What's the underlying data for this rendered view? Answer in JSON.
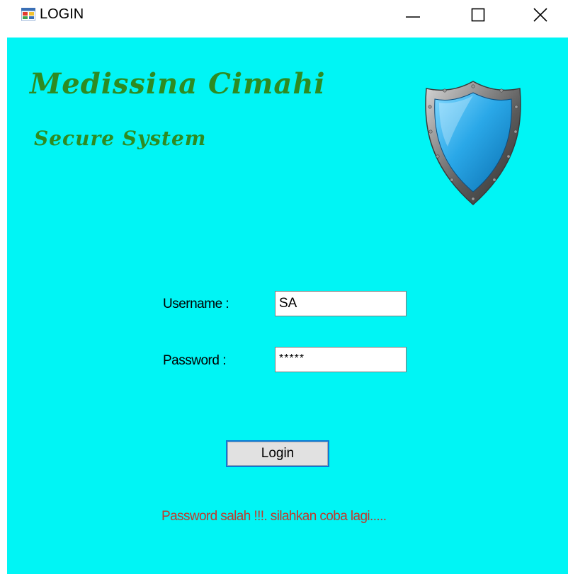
{
  "window": {
    "title": "LOGIN"
  },
  "branding": {
    "title": "Medissina Cimahi",
    "subtitle": "Secure System",
    "brand_color": "#2e8b22",
    "background_color": "#00f5f5"
  },
  "form": {
    "username_label": "Username :",
    "username_value": "SA",
    "password_label": "Password :",
    "password_value": "*****",
    "login_button_label": "Login"
  },
  "status": {
    "error_message": "Password salah !!!. silahkan coba lagi.....",
    "error_color": "#c0392b"
  },
  "icons": {
    "app": "app-window-icon",
    "minimize": "minimize-icon",
    "maximize": "maximize-icon",
    "close": "close-icon",
    "shield": "shield-icon"
  }
}
